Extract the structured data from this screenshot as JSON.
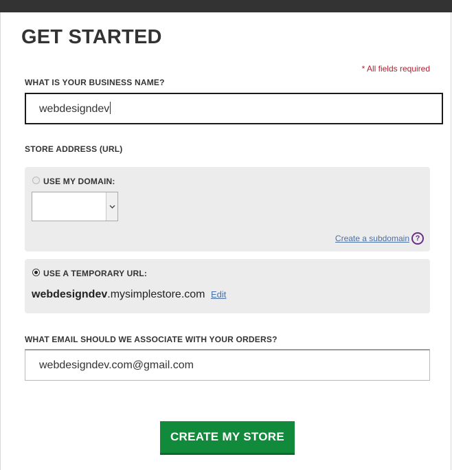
{
  "page": {
    "title": "GET STARTED",
    "required_note": "* All fields required"
  },
  "business": {
    "label": "WHAT IS YOUR BUSINESS NAME?",
    "value": "webdesigndev"
  },
  "store_address": {
    "label": "STORE ADDRESS (URL)",
    "domain_option": {
      "label": "USE MY DOMAIN:",
      "selected": false,
      "select_value": ""
    },
    "create_subdomain_link": "Create a subdomain",
    "help_icon": "?",
    "temp_option": {
      "label": "USE A TEMPORARY URL:",
      "selected": true,
      "name": "webdesigndev",
      "suffix": ".mysimplestore.com",
      "edit_link": "Edit"
    }
  },
  "email": {
    "label": "WHAT EMAIL SHOULD WE ASSOCIATE WITH YOUR ORDERS?",
    "value": "webdesigndev.com@gmail.com"
  },
  "submit": {
    "label": "CREATE MY STORE"
  },
  "icons": {
    "select_arrow": "chevron-down-icon",
    "help": "question-circle-icon"
  },
  "colors": {
    "accent_green": "#118a3b",
    "required_red": "#b01e2f",
    "link_blue": "#4a6fa5",
    "help_purple": "#6a2c8a",
    "panel_gray": "#ececec"
  }
}
